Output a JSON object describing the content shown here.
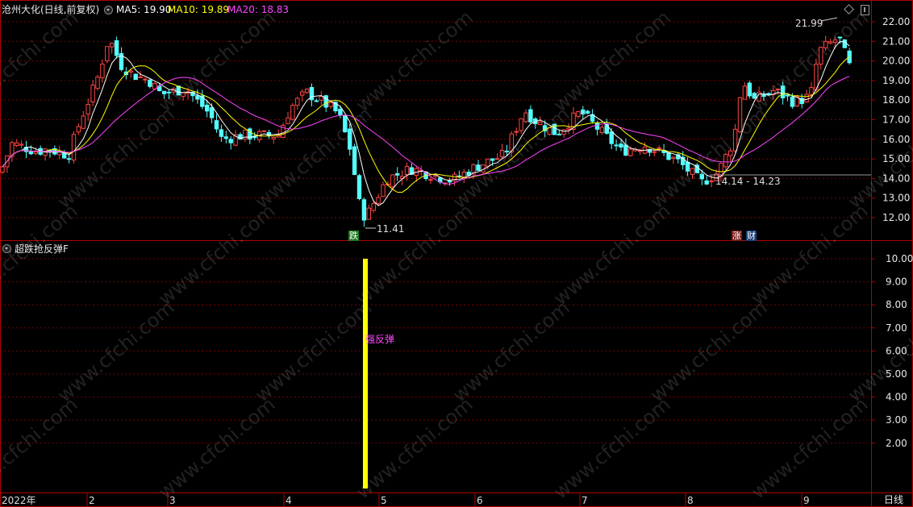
{
  "header": {
    "stock_title": "沧州大化(日线,前复权)",
    "ma5": "MA5: 19.90",
    "ma10": "MA10: 19.89",
    "ma20": "MA20: 18.83"
  },
  "sub_panel": {
    "title": "超跌抢反弹F",
    "signal_text": "强反弹"
  },
  "annotations": {
    "high_label": "21.99",
    "low_label": "11.41",
    "support_range": "14.14 - 14.23",
    "badge_die": "跌",
    "badge_zhang": "涨",
    "badge_cai": "财"
  },
  "time_axis": {
    "labels": [
      "2022年",
      "2",
      "3",
      "4",
      "5",
      "6",
      "7",
      "8",
      "9"
    ]
  },
  "period_label": "日线",
  "colors": {
    "up": "#ff4444",
    "down": "#54ffff",
    "ma5": "#ffffff",
    "ma10": "#ffff00",
    "ma20": "#ff44ff",
    "grid": "#7a0000",
    "frame": "#b00000",
    "signal_bar": "#ffff00"
  },
  "chart_data": [
    {
      "type": "candlestick",
      "title": "沧州大化(日线,前复权)",
      "y_ticks": [
        12.0,
        13.0,
        14.0,
        15.0,
        16.0,
        17.0,
        18.0,
        19.0,
        20.0,
        21.0,
        22.0
      ],
      "ylim": [
        11.0,
        22.6
      ],
      "x_labels": [
        "2022年",
        "2",
        "3",
        "4",
        "5",
        "6",
        "7",
        "8",
        "9"
      ],
      "series": [
        {
          "name": "MA5",
          "values": [
            19.9
          ]
        },
        {
          "name": "MA10",
          "values": [
            19.89
          ]
        },
        {
          "name": "MA20",
          "values": [
            18.83
          ]
        }
      ],
      "annotations": [
        "21.99",
        "11.41",
        "14.14 - 14.23"
      ]
    },
    {
      "type": "bar",
      "title": "超跌抢反弹F",
      "y_ticks": [
        2.0,
        3.0,
        4.0,
        5.0,
        6.0,
        7.0,
        8.0,
        9.0,
        10.0
      ],
      "ylim": [
        0,
        10.5
      ],
      "values": [
        10.0
      ],
      "annotations": [
        "强反弹"
      ]
    }
  ]
}
